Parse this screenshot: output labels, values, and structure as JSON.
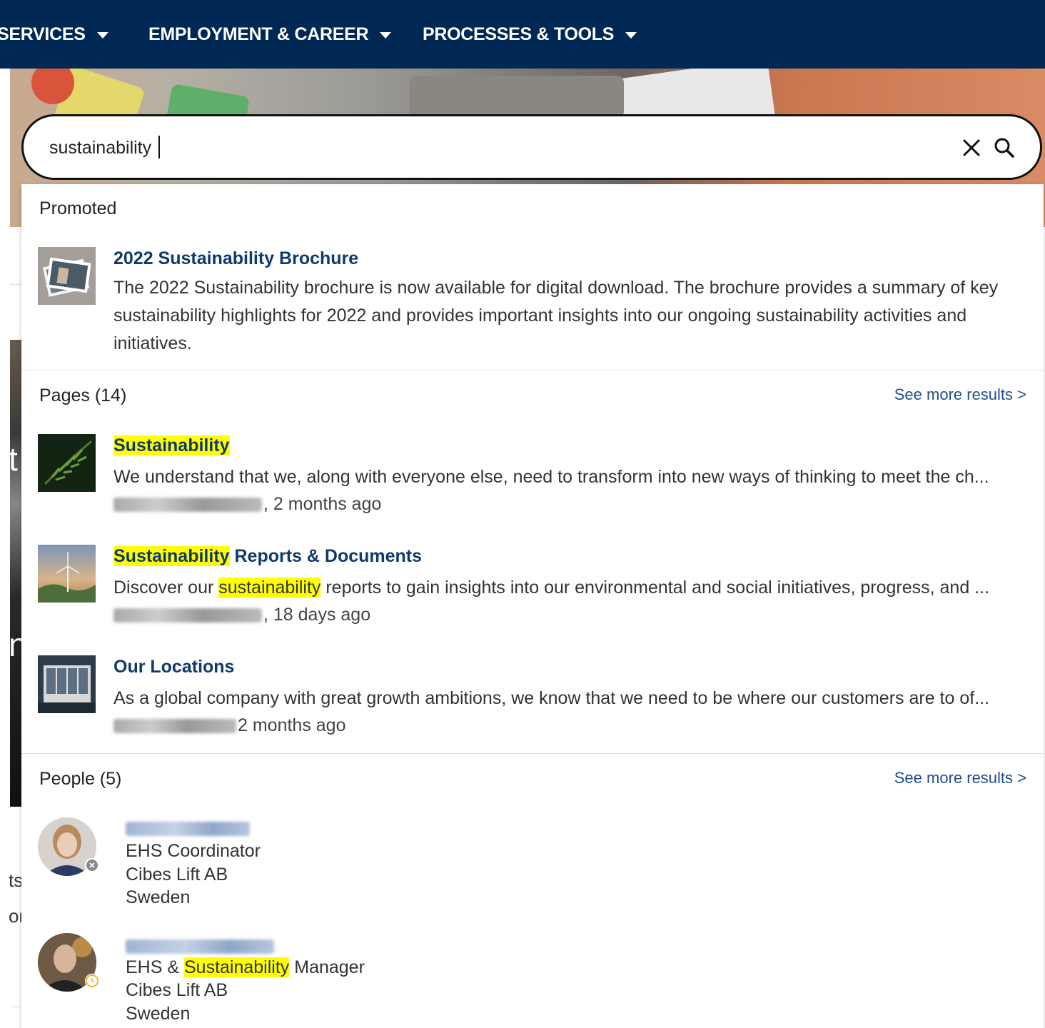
{
  "nav": {
    "items": [
      {
        "label": "SERVICES"
      },
      {
        "label": "EMPLOYMENT & CAREER"
      },
      {
        "label": "PROCESSES & TOOLS"
      }
    ]
  },
  "search": {
    "value": "sustainability"
  },
  "promoted": {
    "header": "Promoted",
    "item": {
      "title": "2022 Sustainability Brochure",
      "desc": "The 2022 Sustainability brochure is now available for digital download. The brochure provides a summary of key sustainability highlights for 2022 and provides important insights into our ongoing sustainability activities and initiatives."
    }
  },
  "pages": {
    "header": "Pages (14)",
    "see_more": "See more results >",
    "items": [
      {
        "title_hl": "Sustainability",
        "title_rest": "",
        "desc_pre": "We understand that we, along with everyone else, need to transform into new ways of thinking to meet the ch...",
        "desc_hl": "",
        "desc_post": "",
        "meta": ", 2 months ago"
      },
      {
        "title_hl": "Sustainability",
        "title_rest": " Reports & Documents",
        "desc_pre": "Discover our ",
        "desc_hl": "sustainability",
        "desc_post": " reports to gain insights into our environmental and social initiatives, progress, and ...",
        "meta": ", 18 days ago"
      },
      {
        "title_hl": "",
        "title_rest": "Our Locations",
        "desc_pre": "As a global company with great growth ambitions, we know that we need to be where our customers are to of...",
        "desc_hl": "",
        "desc_post": "",
        "meta": " 2 months ago"
      }
    ]
  },
  "people": {
    "header": "People (5)",
    "see_more": "See more results >",
    "items": [
      {
        "role_pre": "EHS Coordinator",
        "role_hl": "",
        "role_post": "",
        "company": "Cibes Lift AB",
        "country": "Sweden"
      },
      {
        "role_pre": "EHS & ",
        "role_hl": "Sustainability",
        "role_post": " Manager",
        "company": "Cibes Lift AB",
        "country": "Sweden"
      }
    ]
  },
  "colors": {
    "nav_bg": "#002855",
    "link": "#0f3a6e",
    "see_more": "#1d4f8c",
    "highlight": "#ffff00"
  }
}
